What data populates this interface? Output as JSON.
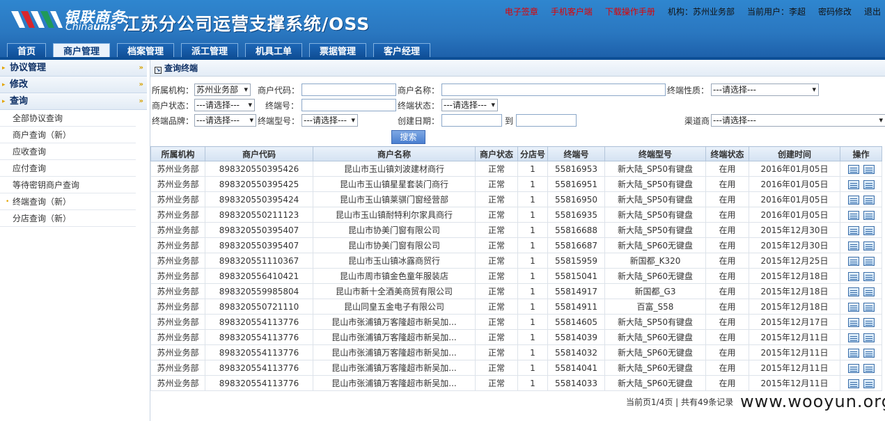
{
  "header": {
    "logo_cn": "银联商务",
    "logo_en_a": "China",
    "logo_en_b": "ums",
    "system_title": "江苏分公司运营支撑系统/OSS",
    "links": {
      "e_sign": "电子签章",
      "mobile_client": "手机客户端",
      "download_manual": "下载操作手册",
      "org": "机构：苏州业务部",
      "current_user": "当前用户：李超",
      "change_password": "密码修改",
      "logout": "退出"
    }
  },
  "nav": {
    "tabs": [
      "首页",
      "商户管理",
      "档案管理",
      "派工管理",
      "机具工单",
      "票据管理",
      "客户经理"
    ],
    "active": 1
  },
  "sidebar": {
    "sections": [
      "协议管理",
      "修改",
      "查询"
    ],
    "items": [
      "全部协议查询",
      "商户查询（新）",
      "应收查询",
      "应付查询",
      "等待密钥商户查询",
      "终端查询（新）",
      "分店查询（新）"
    ]
  },
  "main": {
    "title": "查询终端",
    "form": {
      "org_label": "所属机构：",
      "org_value": "苏州业务部",
      "merchant_code_label": "商户代码：",
      "merchant_name_label": "商户名称：",
      "terminal_nature_label": "终端性质：",
      "merchant_status_label": "商户状态：",
      "terminal_no_label": "终端号：",
      "terminal_status_label": "终端状态：",
      "terminal_brand_label": "终端品牌：",
      "terminal_model_label": "终端型号：",
      "create_date_label": "创建日期：",
      "to_label": "到",
      "channel_label": "渠道商",
      "select_placeholder": "---请选择---",
      "search_button": "搜索"
    },
    "table": {
      "headers": [
        "所属机构",
        "商户代码",
        "商户名称",
        "商户状态",
        "分店号",
        "终端号",
        "终端型号",
        "终端状态",
        "创建时间",
        "操作"
      ],
      "rows": [
        [
          "苏州业务部",
          "898320550395426",
          "昆山市玉山镇刘波建材商行",
          "正常",
          "1",
          "55816953",
          "新大陆_SP50有键盘",
          "在用",
          "2016年01月05日"
        ],
        [
          "苏州业务部",
          "898320550395425",
          "昆山市玉山镇星星套装门商行",
          "正常",
          "1",
          "55816951",
          "新大陆_SP50有键盘",
          "在用",
          "2016年01月05日"
        ],
        [
          "苏州业务部",
          "898320550395424",
          "昆山市玉山镇莱骐门窗经营部",
          "正常",
          "1",
          "55816950",
          "新大陆_SP50有键盘",
          "在用",
          "2016年01月05日"
        ],
        [
          "苏州业务部",
          "898320550211123",
          "昆山市玉山镇耐特利尔家具商行",
          "正常",
          "1",
          "55816935",
          "新大陆_SP50有键盘",
          "在用",
          "2016年01月05日"
        ],
        [
          "苏州业务部",
          "898320550395407",
          "昆山市协美门窗有限公司",
          "正常",
          "1",
          "55816688",
          "新大陆_SP50有键盘",
          "在用",
          "2015年12月30日"
        ],
        [
          "苏州业务部",
          "898320550395407",
          "昆山市协美门窗有限公司",
          "正常",
          "1",
          "55816687",
          "新大陆_SP60无键盘",
          "在用",
          "2015年12月30日"
        ],
        [
          "苏州业务部",
          "898320551110367",
          "昆山市玉山镇冰露商贸行",
          "正常",
          "1",
          "55815959",
          "新国都_K320",
          "在用",
          "2015年12月25日"
        ],
        [
          "苏州业务部",
          "898320556410421",
          "昆山市周市镇金色童年服装店",
          "正常",
          "1",
          "55815041",
          "新大陆_SP60无键盘",
          "在用",
          "2015年12月18日"
        ],
        [
          "苏州业务部",
          "898320559985804",
          "昆山市新十全酒美商贸有限公司",
          "正常",
          "1",
          "55814917",
          "新国都_G3",
          "在用",
          "2015年12月18日"
        ],
        [
          "苏州业务部",
          "898320550721110",
          "昆山同皇五金电子有限公司",
          "正常",
          "1",
          "55814911",
          "百富_S58",
          "在用",
          "2015年12月18日"
        ],
        [
          "苏州业务部",
          "898320554113776",
          "昆山市张浦镇万客隆超市新吴加...",
          "正常",
          "1",
          "55814605",
          "新大陆_SP50有键盘",
          "在用",
          "2015年12月17日"
        ],
        [
          "苏州业务部",
          "898320554113776",
          "昆山市张浦镇万客隆超市新吴加...",
          "正常",
          "1",
          "55814039",
          "新大陆_SP60无键盘",
          "在用",
          "2015年12月11日"
        ],
        [
          "苏州业务部",
          "898320554113776",
          "昆山市张浦镇万客隆超市新吴加...",
          "正常",
          "1",
          "55814032",
          "新大陆_SP60无键盘",
          "在用",
          "2015年12月11日"
        ],
        [
          "苏州业务部",
          "898320554113776",
          "昆山市张浦镇万客隆超市新吴加...",
          "正常",
          "1",
          "55814041",
          "新大陆_SP60无键盘",
          "在用",
          "2015年12月11日"
        ],
        [
          "苏州业务部",
          "898320554113776",
          "昆山市张浦镇万客隆超市新吴加...",
          "正常",
          "1",
          "55814033",
          "新大陆_SP60无键盘",
          "在用",
          "2015年12月11日"
        ]
      ]
    },
    "pager": "当前页1/4页 | 共有49条记录",
    "watermark": "www.wooyun.org"
  }
}
